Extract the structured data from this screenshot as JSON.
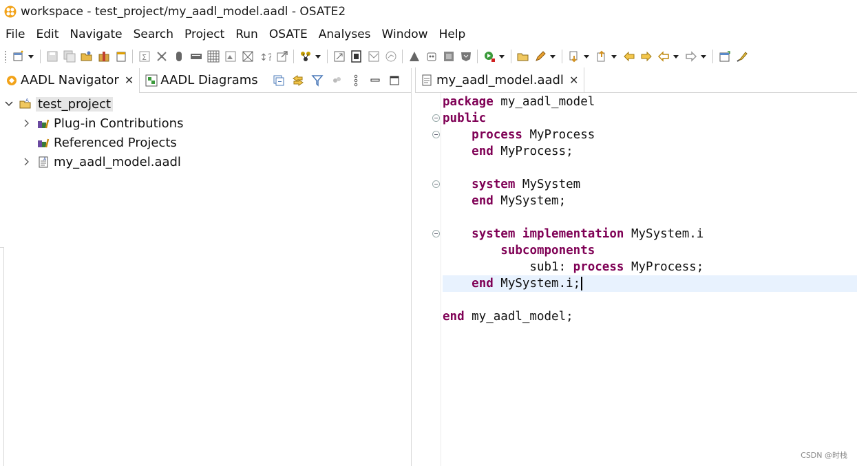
{
  "window": {
    "title": "workspace - test_project/my_aadl_model.aadl - OSATE2"
  },
  "menu": [
    "File",
    "Edit",
    "Navigate",
    "Search",
    "Project",
    "Run",
    "OSATE",
    "Analyses",
    "Window",
    "Help"
  ],
  "left_panel": {
    "tabs": [
      {
        "label": "AADL Navigator",
        "active": true,
        "closable": true
      },
      {
        "label": "AADL Diagrams",
        "active": false,
        "closable": false
      }
    ],
    "tree": [
      {
        "label": "test_project",
        "level": 0,
        "expanded": true,
        "selected": true,
        "icon": "project-folder-icon"
      },
      {
        "label": "Plug-in Contributions",
        "level": 1,
        "expandable": true,
        "icon": "library-icon"
      },
      {
        "label": "Referenced Projects",
        "level": 1,
        "expandable": false,
        "icon": "library-icon"
      },
      {
        "label": "my_aadl_model.aadl",
        "level": 1,
        "expandable": true,
        "icon": "aadl-file-icon"
      }
    ]
  },
  "editor": {
    "tab_label": "my_aadl_model.aadl",
    "lines": [
      [
        {
          "t": "package",
          "k": true
        },
        {
          "t": " my_aadl_model",
          "k": false
        }
      ],
      [
        {
          "t": "public",
          "k": true
        }
      ],
      [
        {
          "t": "    ",
          "k": false
        },
        {
          "t": "process",
          "k": true
        },
        {
          "t": " MyProcess",
          "k": false
        }
      ],
      [
        {
          "t": "    ",
          "k": false
        },
        {
          "t": "end",
          "k": true
        },
        {
          "t": " MyProcess;",
          "k": false
        }
      ],
      [],
      [
        {
          "t": "    ",
          "k": false
        },
        {
          "t": "system",
          "k": true
        },
        {
          "t": " MySystem",
          "k": false
        }
      ],
      [
        {
          "t": "    ",
          "k": false
        },
        {
          "t": "end",
          "k": true
        },
        {
          "t": " MySystem;",
          "k": false
        }
      ],
      [],
      [
        {
          "t": "    ",
          "k": false
        },
        {
          "t": "system implementation",
          "k": true
        },
        {
          "t": " MySystem.i",
          "k": false
        }
      ],
      [
        {
          "t": "        ",
          "k": false
        },
        {
          "t": "subcomponents",
          "k": true
        }
      ],
      [
        {
          "t": "            sub1: ",
          "k": false
        },
        {
          "t": "process",
          "k": true
        },
        {
          "t": " MyProcess;",
          "k": false
        }
      ],
      [
        {
          "t": "    ",
          "k": false
        },
        {
          "t": "end",
          "k": true
        },
        {
          "t": " MySystem.i;",
          "k": false
        }
      ],
      [],
      [
        {
          "t": "end",
          "k": true
        },
        {
          "t": " my_aadl_model;",
          "k": false
        }
      ]
    ],
    "fold_lines": [
      1,
      2,
      5,
      8
    ],
    "current_line": 11
  },
  "watermark": "CSDN @时栈",
  "colors": {
    "keyword": "#7f0055",
    "current_line": "#e8f2fe",
    "selection": "#e6e6e6"
  }
}
